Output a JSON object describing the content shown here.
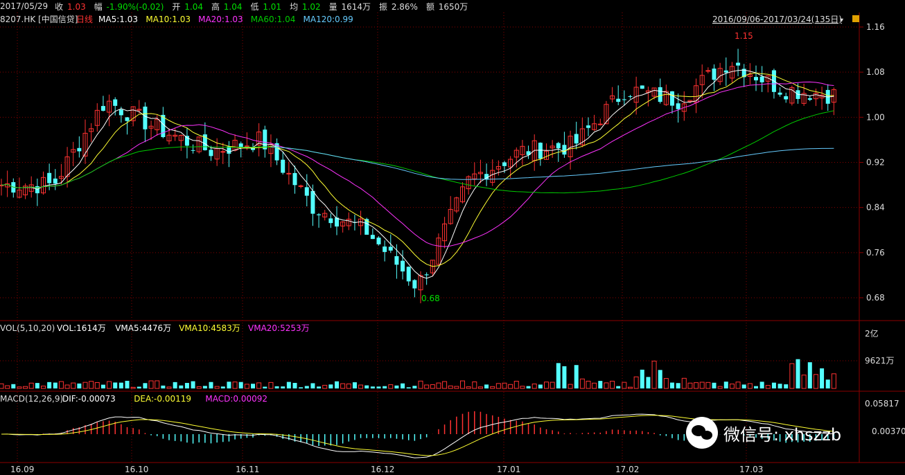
{
  "quote": {
    "date": "2017/05/29",
    "items": [
      {
        "label": "收",
        "value": "1.03",
        "color": "#ff3232"
      },
      {
        "label": "幅",
        "value": "-1.90%(-0.02)",
        "color": "#00e000"
      },
      {
        "label": "开",
        "value": "1.04",
        "color": "#00e000"
      },
      {
        "label": "高",
        "value": "1.04",
        "color": "#00e000"
      },
      {
        "label": "低",
        "value": "1.01",
        "color": "#00e000"
      },
      {
        "label": "均",
        "value": "1.02",
        "color": "#00e000"
      },
      {
        "label": "量",
        "value": "1614万",
        "color": "#dddddd"
      },
      {
        "label": "振",
        "value": "2.86%",
        "color": "#dddddd"
      },
      {
        "label": "额",
        "value": "1650万",
        "color": "#dddddd"
      }
    ]
  },
  "price_panel": {
    "code": "8207.HK [中国信贷]",
    "period": "日线",
    "indicators": [
      {
        "text": "MA5:1.03",
        "color": "#ffffff"
      },
      {
        "text": "MA10:1.03",
        "color": "#ffff33"
      },
      {
        "text": "MA20:1.03",
        "color": "#ff33ff"
      },
      {
        "text": "MA60:1.04",
        "color": "#00cc00"
      },
      {
        "text": "MA120:0.99",
        "color": "#66ccff"
      }
    ],
    "range_label": "2016/09/06-2017/03/24(135日)",
    "y_ticks": [
      "1.16",
      "1.08",
      "1.00",
      "0.92",
      "0.84",
      "0.76",
      "0.68"
    ],
    "high_marker": "1.15",
    "low_marker": "0.68"
  },
  "volume_panel": {
    "label": "VOL(5,10,20)",
    "indicators": [
      {
        "text": "VOL:1614万",
        "color": "#ffffff"
      },
      {
        "text": "VMA5:4476万",
        "color": "#ffffff"
      },
      {
        "text": "VMA10:4583万",
        "color": "#ffff33"
      },
      {
        "text": "VMA20:5253万",
        "color": "#ff33ff"
      }
    ],
    "y_ticks": [
      "2亿",
      "9621万"
    ]
  },
  "macd_panel": {
    "label": "MACD(12,26,9)",
    "indicators": [
      {
        "text": "DIF:-0.00073",
        "color": "#ffffff"
      },
      {
        "text": "DEA:-0.00119",
        "color": "#ffff33"
      },
      {
        "text": "MACD:0.00092",
        "color": "#ff33ff"
      }
    ],
    "y_ticks": [
      "0.05817",
      "0.00370"
    ]
  },
  "x_axis": [
    "16.09",
    "16.10",
    "16.11",
    "16.12",
    "17.01",
    "17.02",
    "17.03"
  ],
  "watermark": "微信号: xhszzb",
  "colors": {
    "up": "#ff3232",
    "down": "#54ffff",
    "ma5": "#ffffff",
    "ma10": "#ffff33",
    "ma20": "#ff33ff",
    "ma60": "#00cc00",
    "ma120": "#66ccff",
    "grid": "#8b0000"
  },
  "chart_data": {
    "type": "candlestick",
    "range": "2016/09/06-2017/03/24",
    "ylim": [
      0.66,
      1.17
    ],
    "close_anchors": [
      {
        "x": "16.09",
        "close": 0.88
      },
      {
        "x": "16.09 mid",
        "close": 0.88
      },
      {
        "x": "16.09 late",
        "close": 1.03
      },
      {
        "x": "16.10",
        "close": 0.98
      },
      {
        "x": "16.10 mid",
        "close": 0.94
      },
      {
        "x": "16.11",
        "close": 0.96
      },
      {
        "x": "16.11 late",
        "close": 0.84
      },
      {
        "x": "16.12",
        "close": 0.8
      },
      {
        "x": "16.12 late",
        "close": 0.7
      },
      {
        "x": "17.01 early",
        "close": 0.89
      },
      {
        "x": "17.01",
        "close": 0.94
      },
      {
        "x": "17.01 late",
        "close": 0.95
      },
      {
        "x": "17.02",
        "close": 1.05
      },
      {
        "x": "17.02 late",
        "close": 1.03
      },
      {
        "x": "17.03 early",
        "close": 1.1
      },
      {
        "x": "17.03",
        "close": 1.05
      },
      {
        "x": "17.03 late",
        "close": 1.04
      }
    ],
    "high": 1.15,
    "low": 0.68,
    "volume_ylim_label": [
      "2亿",
      "9621万"
    ],
    "macd_ylim": [
      -0.03,
      0.058
    ]
  }
}
